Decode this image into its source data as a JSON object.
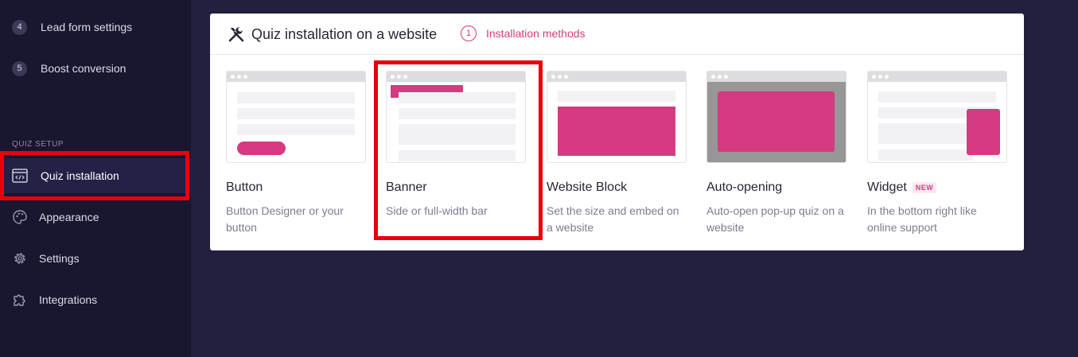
{
  "sidebar": {
    "steps": [
      {
        "num": "4",
        "label": "Lead form settings"
      },
      {
        "num": "5",
        "label": "Boost conversion"
      }
    ],
    "section_label": "QUIZ SETUP",
    "nav": [
      {
        "label": "Quiz installation",
        "icon": "code-window-icon",
        "active": true
      },
      {
        "label": "Appearance",
        "icon": "palette-icon"
      },
      {
        "label": "Settings",
        "icon": "gear-icon"
      },
      {
        "label": "Integrations",
        "icon": "puzzle-icon"
      }
    ]
  },
  "card": {
    "title": "Quiz installation on a website",
    "title_icon": "tools-icon",
    "step_number": "1",
    "step_label": "Installation methods",
    "methods": [
      {
        "title": "Button",
        "desc": "Button Designer or your button"
      },
      {
        "title": "Banner",
        "desc": "Side or full-width bar"
      },
      {
        "title": "Website Block",
        "desc": "Set the size and embed on a website"
      },
      {
        "title": "Auto-opening",
        "desc": "Auto-open pop-up quiz on a website"
      },
      {
        "title": "Widget",
        "badge": "NEW",
        "desc": "In the bottom right like online support"
      }
    ]
  },
  "colors": {
    "accent": "#d43b80",
    "sidebar_bg": "#181730",
    "page_bg": "#22203f",
    "highlight": "#e8000b"
  }
}
